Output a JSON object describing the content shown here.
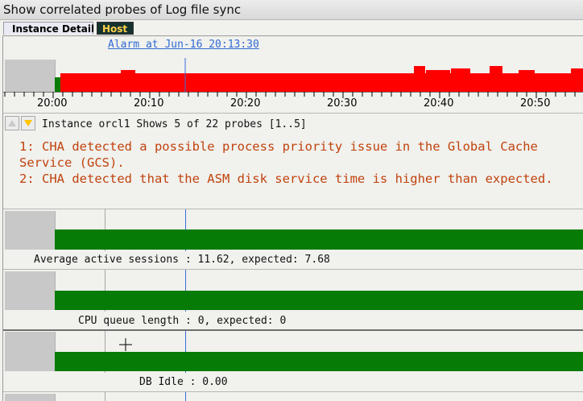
{
  "window": {
    "title": "Show correlated probes of Log file sync"
  },
  "tabs": [
    {
      "label": "Instance Detail",
      "selected": true
    },
    {
      "label": "Host",
      "selected": false
    }
  ],
  "alarm": {
    "label": "Alarm at Jun-16 20:13:30"
  },
  "timeline": {
    "ticks": [
      "20:00",
      "20:10",
      "20:20",
      "20:30",
      "20:40",
      "20:50"
    ]
  },
  "probe_header": {
    "instance_text": "Instance orcl1  Shows 5 of 22 probes [1..5]"
  },
  "issues": [
    "1: CHA detected a possible process priority issue in the Global Cache Service (GCS).",
    "2: CHA detected that the ASM disk service time is higher than expected."
  ],
  "metrics": [
    {
      "label": "Average active sessions : 11.62, expected: 7.68"
    },
    {
      "label": "CPU queue length : 0, expected: 0"
    },
    {
      "label": "DB Idle : 0.00"
    }
  ],
  "colors": {
    "alarm_bar": "#ff0000",
    "ok_bar": "#067b06",
    "issue_text": "#c0430e",
    "link": "#2f6bd6",
    "host_tab_bg": "#15322f",
    "host_tab_fg": "#ffd24a"
  },
  "icons": [
    "up-arrow-icon",
    "down-arrow-icon",
    "crosshair-cursor-icon"
  ]
}
